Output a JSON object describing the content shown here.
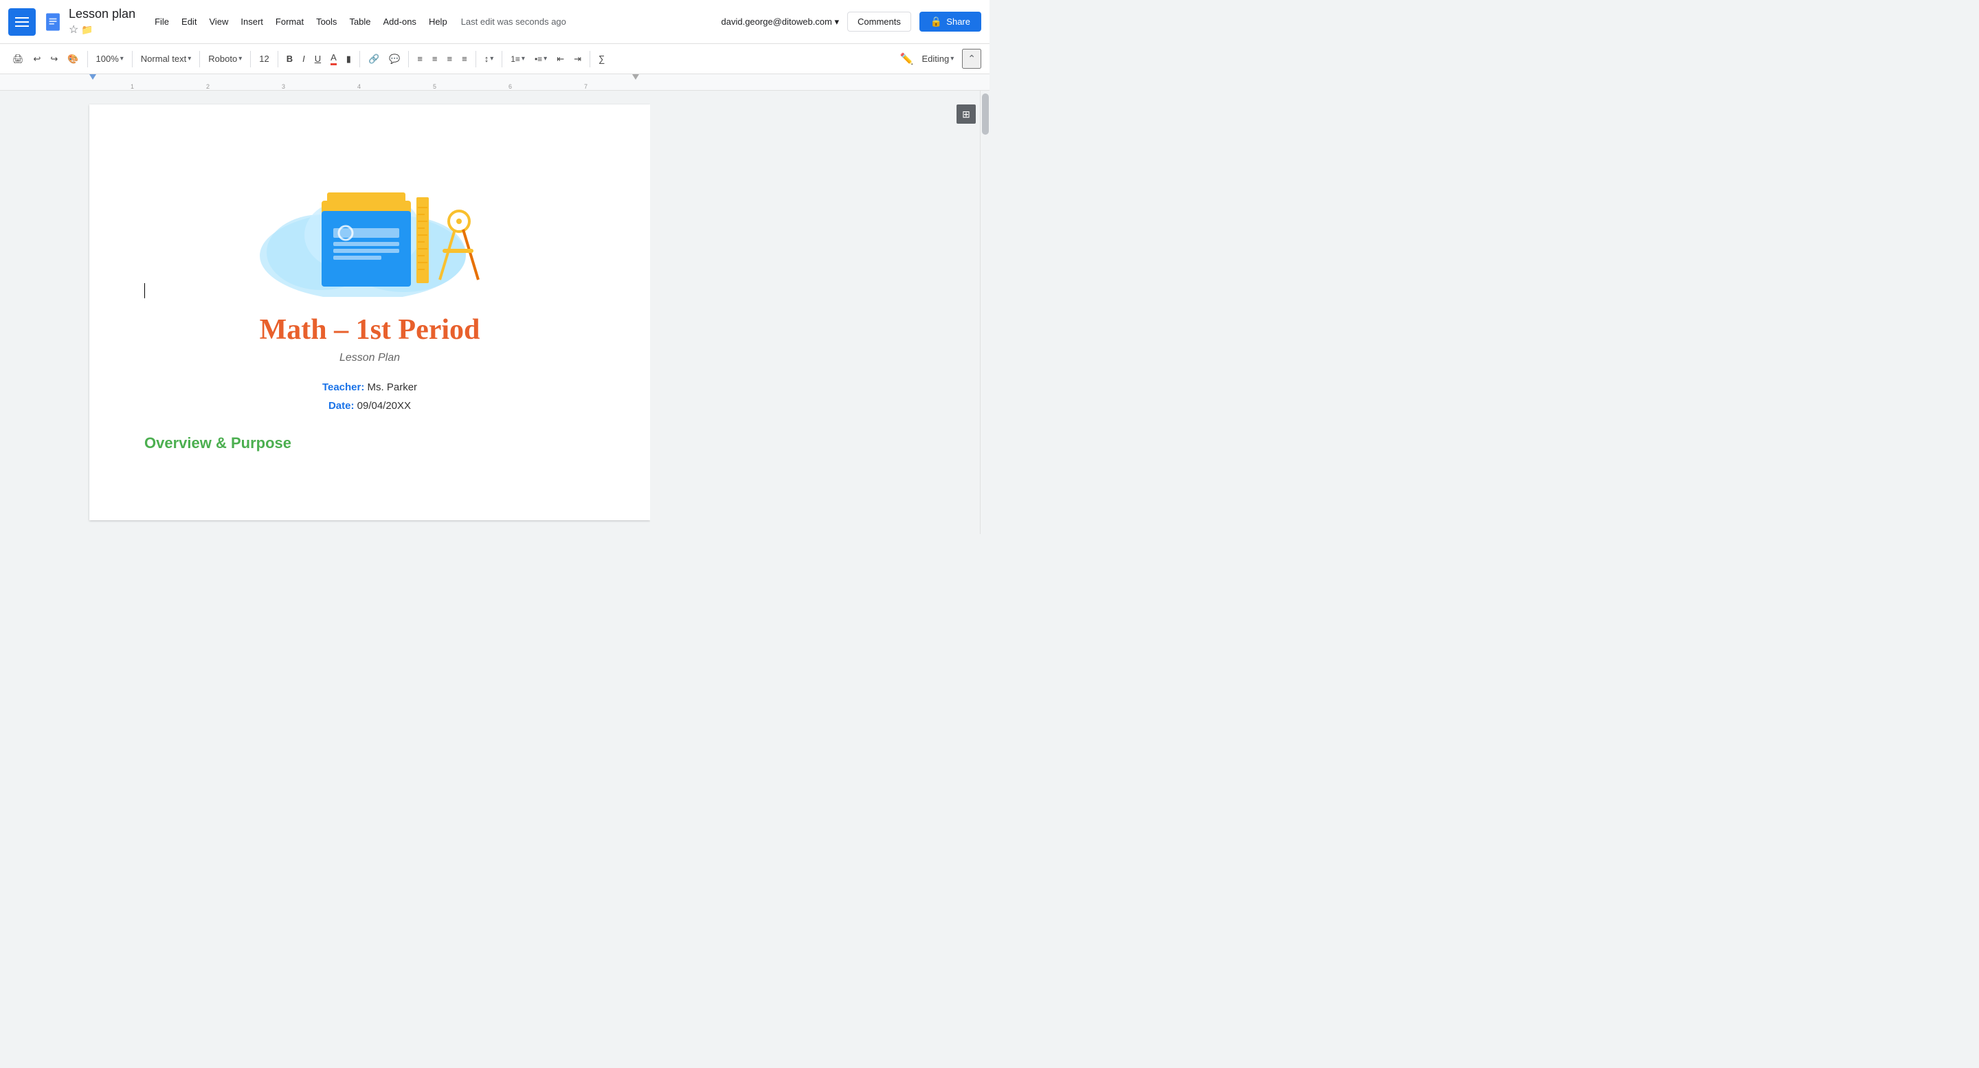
{
  "app": {
    "menu_icon": "☰",
    "doc_title": "Lesson plan",
    "star_icon": "☆",
    "folder_icon": "📁",
    "save_status": "Last edit was seconds ago",
    "user_email": "david.george@ditoweb.com ▾",
    "comments_label": "Comments",
    "share_label": "Share",
    "share_lock": "🔒"
  },
  "menu": {
    "file": "File",
    "edit": "Edit",
    "view": "View",
    "insert": "Insert",
    "format": "Format",
    "tools": "Tools",
    "table": "Table",
    "addons": "Add-ons",
    "help": "Help"
  },
  "toolbar": {
    "print": "🖨",
    "undo": "↩",
    "redo": "↪",
    "paint": "🎨",
    "zoom": "100%",
    "zoom_arrow": "▾",
    "text_style": "Normal text",
    "text_style_arrow": "▾",
    "font": "Roboto",
    "font_arrow": "▾",
    "font_size": "12",
    "font_size_arrow": "▾",
    "bold": "B",
    "italic": "I",
    "underline": "U",
    "text_color": "A",
    "highlight": "▮",
    "link": "🔗",
    "comment": "💬",
    "align_left": "≡",
    "align_center": "≡",
    "align_right": "≡",
    "align_justify": "≡",
    "line_spacing": "↕",
    "line_spacing_arrow": "▾",
    "numbered_list": "1≡",
    "numbered_list_arrow": "▾",
    "bullet_list": "•≡",
    "bullet_list_arrow": "▾",
    "decrease_indent": "⇤",
    "increase_indent": "⇥",
    "formula": "∑",
    "editing_mode": "Editing",
    "editing_arrow": "▾",
    "collapse": "⌃"
  },
  "document": {
    "main_title": "Math – 1st Period",
    "subtitle": "Lesson Plan",
    "teacher_label": "Teacher:",
    "teacher_value": "Ms. Parker",
    "date_label": "Date:",
    "date_value": "09/04/20XX",
    "section_title": "Overview & Purpose"
  }
}
